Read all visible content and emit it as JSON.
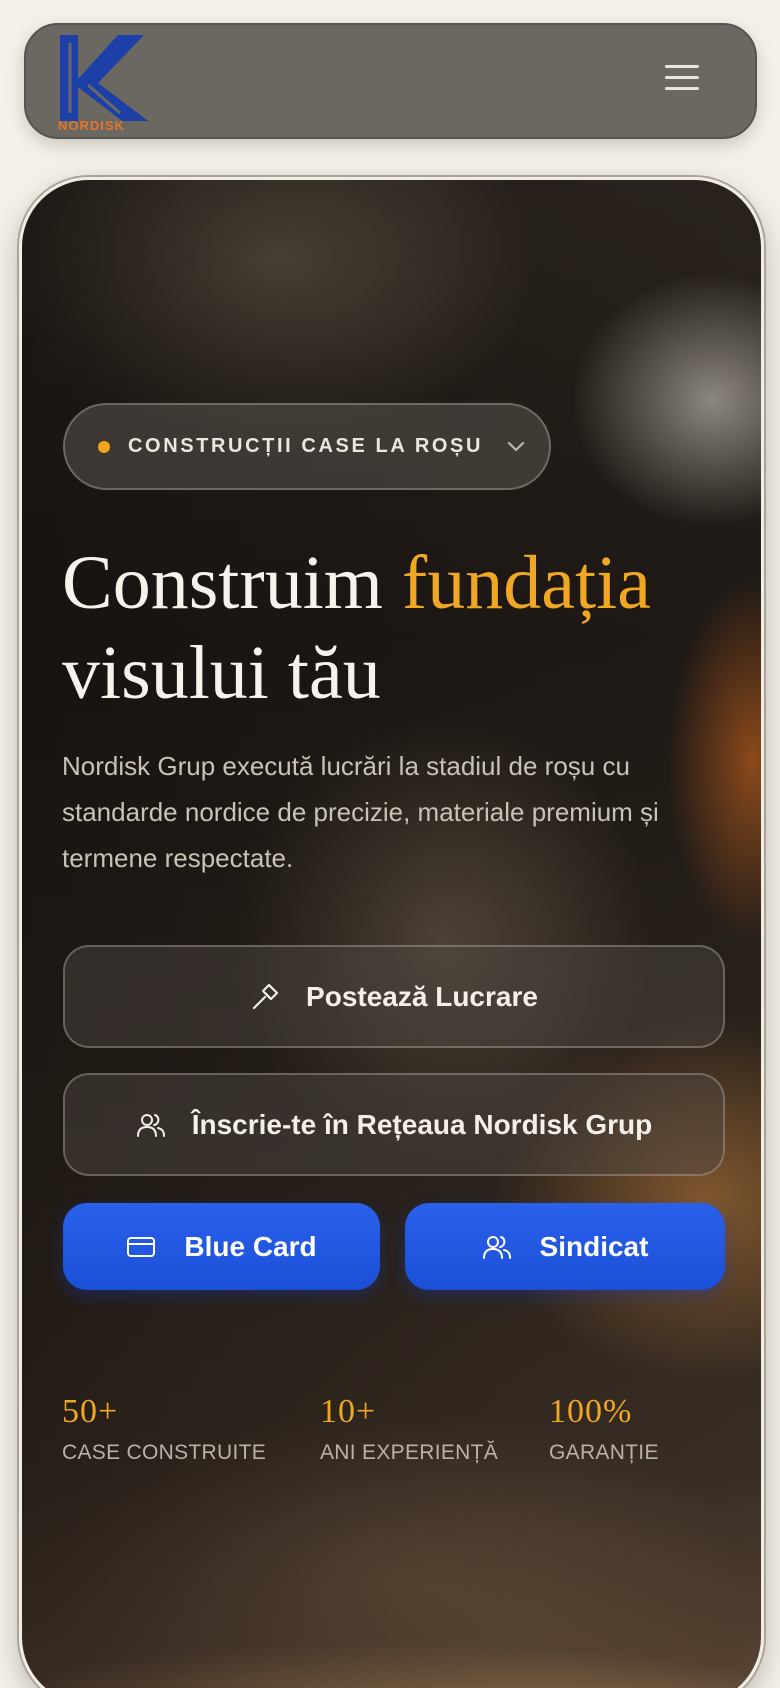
{
  "header": {
    "logo_letter": "K",
    "logo_text": "NORDISK",
    "menu_icon": "hamburger-menu-icon",
    "colors": {
      "logo_blue": "#1c3fa8",
      "logo_orange": "#e4762a"
    }
  },
  "hero": {
    "badge": {
      "label": "CONSTRUCȚII CASE LA ROȘU",
      "dot_color": "#f2a51c",
      "icon": "chevron-down-icon"
    },
    "headline": {
      "part1": "Construim ",
      "accent": "fundația",
      "part2": "visului tău"
    },
    "subtitle": "Nordisk Grup execută lucrări la stadiul de roșu cu standarde nordice de precizie, materiale premium și termene respectate.",
    "buttons": {
      "post_work": {
        "label": "Postează Lucrare",
        "icon": "hammer-icon"
      },
      "join_network": {
        "label": "Înscrie-te în Rețeaua Nordisk Grup",
        "icon": "users-icon"
      },
      "blue_card": {
        "label": "Blue Card",
        "icon": "credit-card-icon"
      },
      "syndicate": {
        "label": "Sindicat",
        "icon": "users-icon"
      }
    },
    "stats": [
      {
        "value": "50+",
        "label": "CASE CONSTRUITE"
      },
      {
        "value": "10+",
        "label": "ANI EXPERIENȚĂ"
      },
      {
        "value": "100%",
        "label": "GARANȚIE"
      }
    ],
    "colors": {
      "accent": "#f0a723",
      "primary_blue": "#1b4fd8"
    }
  }
}
